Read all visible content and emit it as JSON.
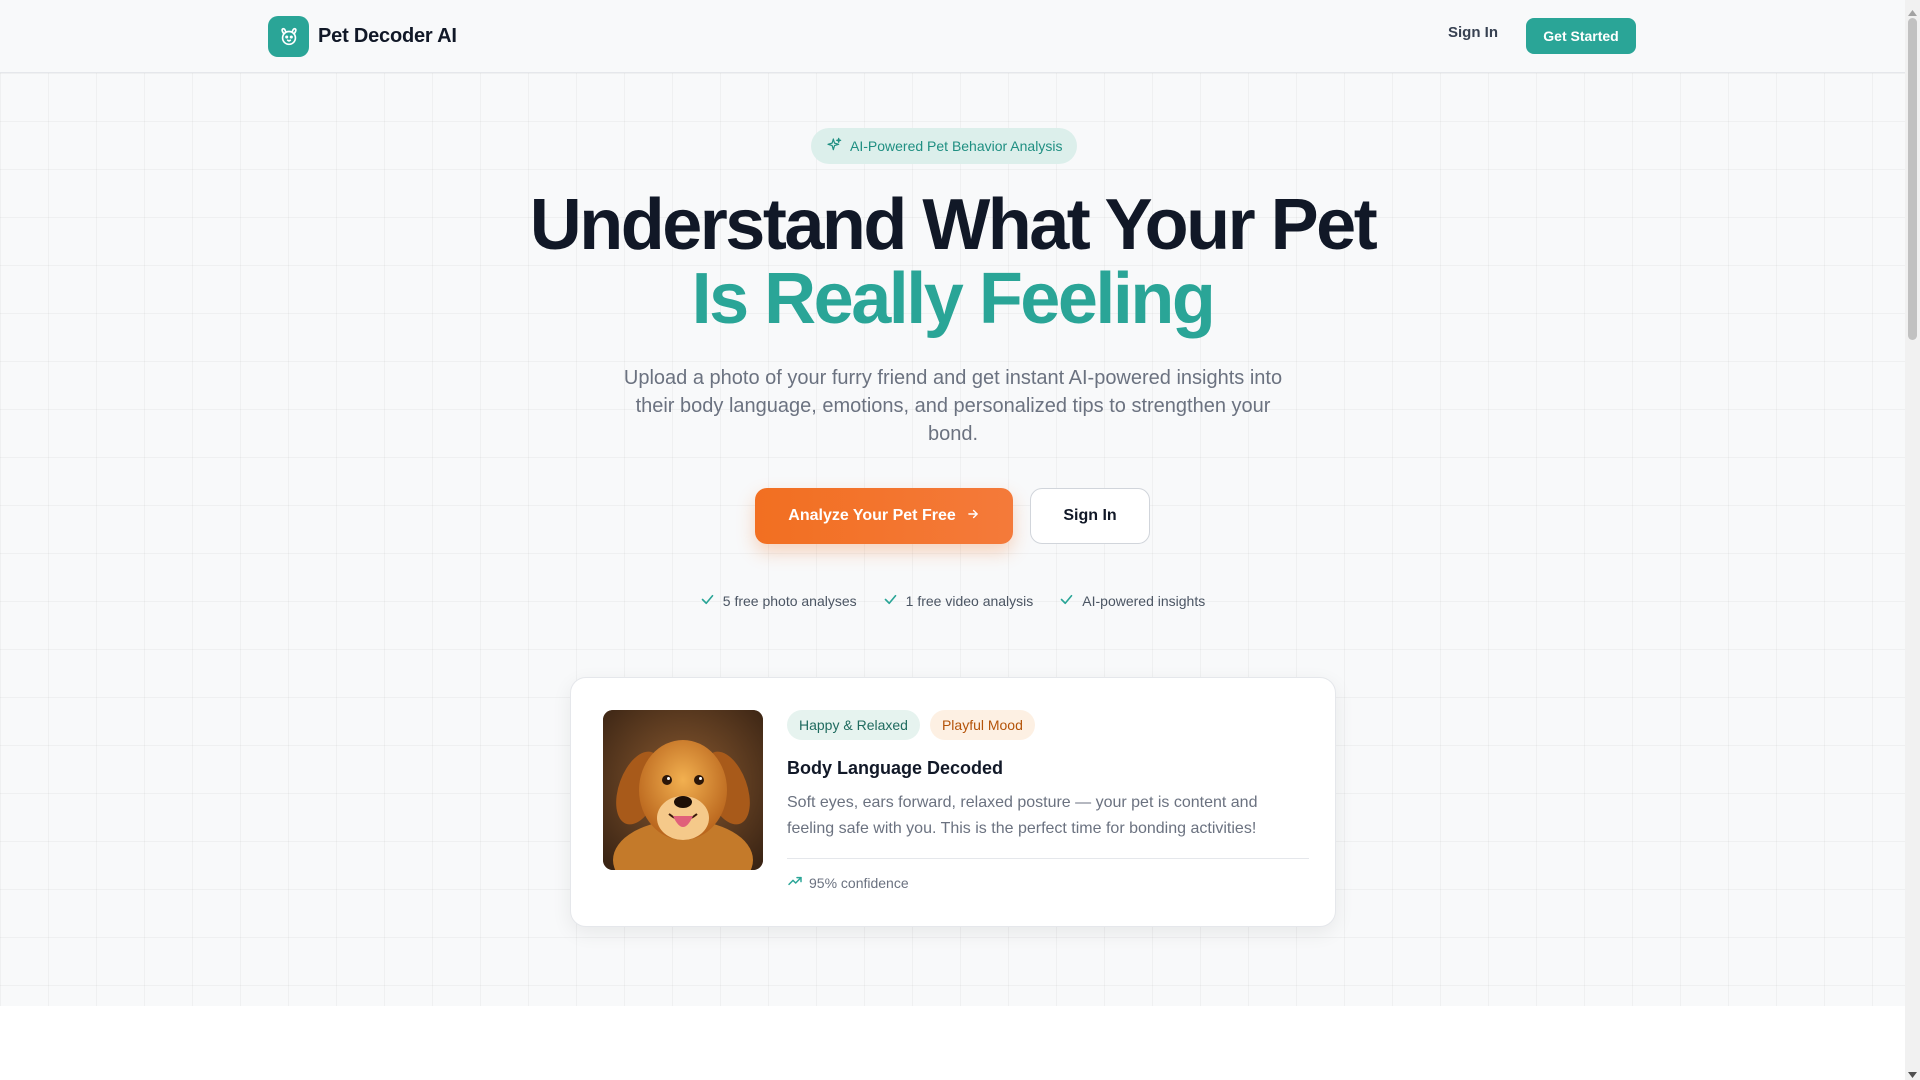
{
  "header": {
    "brand_name": "Pet Decoder AI",
    "brand_icon": "paw-face-icon",
    "nav_signin": "Sign In",
    "nav_get_started": "Get Started"
  },
  "hero": {
    "badge_icon": "sparkles-icon",
    "badge_text": "AI-Powered Pet Behavior Analysis",
    "headline_line1": "Understand What Your Pet",
    "headline_line2": "Is Really Feeling",
    "subtitle": "Upload a photo of your furry friend and get instant AI-powered insights into their body language, emotions, and personalized tips to strengthen your bond.",
    "primary_button": "Analyze Your Pet Free",
    "secondary_button": "Sign In",
    "features": [
      {
        "icon": "check-icon",
        "label": "5 free photo analyses"
      },
      {
        "icon": "check-icon",
        "label": "1 free video analysis"
      },
      {
        "icon": "check-icon",
        "label": "AI-powered insights"
      }
    ]
  },
  "card": {
    "tags": [
      "Happy & Relaxed",
      "Playful Mood"
    ],
    "title": "Body Language Decoded",
    "description": "Soft eyes, ears forward, relaxed posture — your pet is content and feeling safe with you. This is the perfect time for bonding activities!",
    "confidence_icon": "trending-up-icon",
    "confidence": "95% confidence"
  },
  "colors": {
    "teal_accent": "#2aa597",
    "orange_accent": "#f26f21",
    "text_dark": "#111827",
    "text_muted": "#6b7280"
  }
}
